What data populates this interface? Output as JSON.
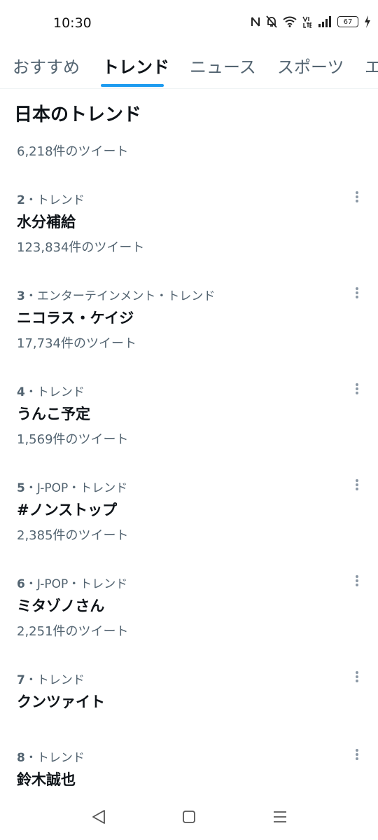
{
  "status_bar": {
    "time": "10:30",
    "battery": "67"
  },
  "tabs": [
    {
      "label": "おすすめ"
    },
    {
      "label": "トレンド"
    },
    {
      "label": "ニュース"
    },
    {
      "label": "スポーツ"
    },
    {
      "label": "エ"
    }
  ],
  "section": {
    "title": "日本のトレンド",
    "first_count": "6,218件のツイート"
  },
  "trends": [
    {
      "rank": "2",
      "category": "・トレンド",
      "name": "水分補給",
      "count": "123,834件のツイート"
    },
    {
      "rank": "3",
      "category": "・エンターテインメント・トレンド",
      "name": "ニコラス・ケイジ",
      "count": "17,734件のツイート"
    },
    {
      "rank": "4",
      "category": "・トレンド",
      "name": "うんこ予定",
      "count": "1,569件のツイート"
    },
    {
      "rank": "5",
      "category": "・J-POP・トレンド",
      "name": "#ノンストップ",
      "count": "2,385件のツイート"
    },
    {
      "rank": "6",
      "category": "・J-POP・トレンド",
      "name": "ミタゾノさん",
      "count": "2,251件のツイート"
    },
    {
      "rank": "7",
      "category": "・トレンド",
      "name": "クンツァイト",
      "count": ""
    },
    {
      "rank": "8",
      "category": "・トレンド",
      "name": "鈴木誠也",
      "count": ""
    }
  ],
  "colors": {
    "accent": "#1d9bf0",
    "text_primary": "#0f1419",
    "text_secondary": "#536471"
  }
}
